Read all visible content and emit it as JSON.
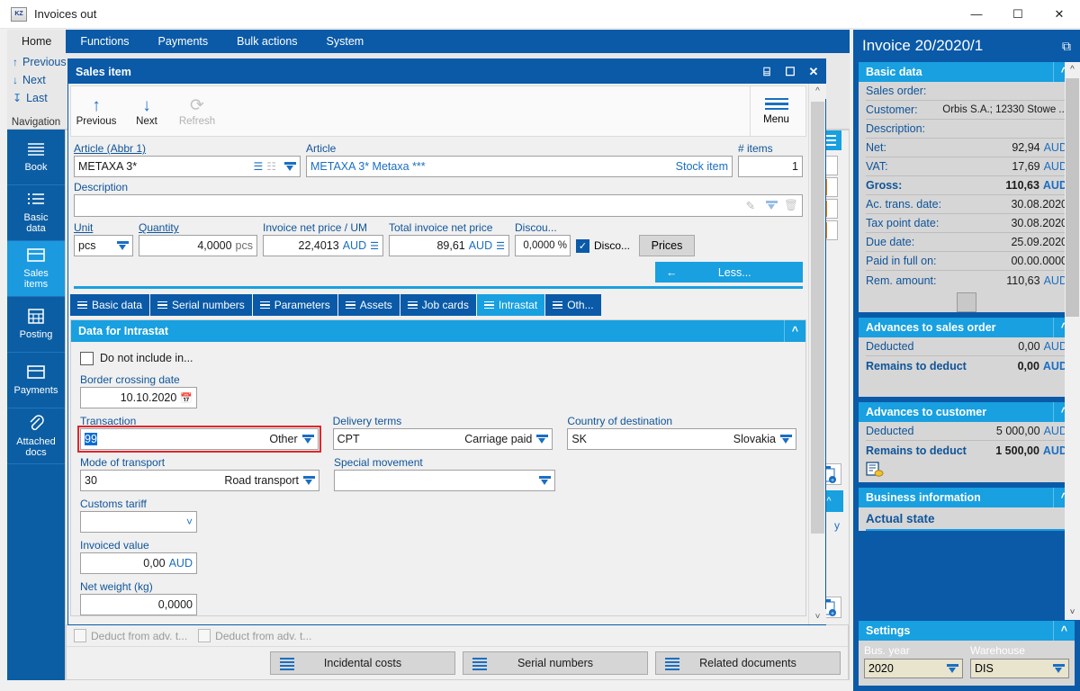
{
  "window": {
    "title": "Invoices out",
    "icon": "app-icon",
    "controls": {
      "minimize": "—",
      "maximize": "☐",
      "close": "✕"
    }
  },
  "ribbon": {
    "tabs": [
      {
        "label": "Home",
        "active": true
      },
      {
        "label": "Functions",
        "active": false
      },
      {
        "label": "Payments",
        "active": false
      },
      {
        "label": "Bulk actions",
        "active": false
      },
      {
        "label": "System",
        "active": false
      }
    ],
    "navigation": {
      "group_label": "Navigation",
      "items": [
        {
          "label": "Previous",
          "arrow": "↑"
        },
        {
          "label": "Next",
          "arrow": "↓"
        },
        {
          "label": "Last",
          "arrow": "↧"
        }
      ]
    }
  },
  "left_nav": {
    "items": [
      {
        "label": "Book",
        "icon": "book-icon",
        "active": false
      },
      {
        "label": "Basic\ndata",
        "icon": "list-icon",
        "active": false
      },
      {
        "label": "Sales\nitems",
        "icon": "box-icon",
        "active": true
      },
      {
        "label": "Posting",
        "icon": "calculator-icon",
        "active": false
      },
      {
        "label": "Payments",
        "icon": "box-icon",
        "active": false
      },
      {
        "label": "Attached\ndocs",
        "icon": "paperclip-icon",
        "active": false
      }
    ]
  },
  "dialog": {
    "title": "Sales item",
    "title_buttons": [
      {
        "name": "save-icon",
        "glyph": "⌸"
      },
      {
        "name": "maximize-icon",
        "glyph": "☐"
      },
      {
        "name": "close-icon",
        "glyph": "✕"
      }
    ],
    "toolbar": {
      "items": [
        {
          "label": "Previous",
          "glyph": "↑",
          "disabled": false
        },
        {
          "label": "Next",
          "glyph": "↓",
          "disabled": false
        },
        {
          "label": "Refresh",
          "glyph": "⟳",
          "disabled": true
        }
      ],
      "menu_label": "Menu"
    },
    "fields": {
      "article_abbr_label": "Article (Abbr 1)",
      "article_abbr_value": "METAXA 3*",
      "article_label": "Article",
      "article_value": "METAXA 3* Metaxa ***",
      "article_suffix": "Stock item",
      "items_label": "# items",
      "items_value": "1",
      "description_label": "Description",
      "description_value": "",
      "unit_label": "Unit",
      "unit_value": "pcs",
      "quantity_label": "Quantity",
      "quantity_value": "4,0000",
      "quantity_unit": "pcs",
      "net_price_label": "Invoice net price / UM",
      "net_price_value": "22,4013",
      "net_price_currency": "AUD",
      "total_net_label": "Total invoice net price",
      "total_net_value": "89,61",
      "total_net_currency": "AUD",
      "discount_label": "Discou...",
      "discount_value": "0,0000 %",
      "discount_check_label": "Disco...",
      "discount_checked": true,
      "prices_button": "Prices",
      "less_button": "Less...",
      "less_arrow": "←"
    },
    "tabs": [
      {
        "label": "Basic data",
        "active": false
      },
      {
        "label": "Serial numbers",
        "active": false
      },
      {
        "label": "Parameters",
        "active": false
      },
      {
        "label": "Assets",
        "active": false
      },
      {
        "label": "Job cards",
        "active": false
      },
      {
        "label": "Intrastat",
        "active": true
      },
      {
        "label": "Oth...",
        "active": false
      }
    ],
    "intrastat": {
      "panel_title": "Data for Intrastat",
      "do_not_include_label": "Do not include in...",
      "do_not_include_checked": false,
      "border_date_label": "Border crossing date",
      "border_date_value": "10.10.2020",
      "transaction_label": "Transaction",
      "transaction_code": "99",
      "transaction_text": "Other",
      "transaction_highlighted": true,
      "delivery_terms_label": "Delivery terms",
      "delivery_terms_code": "CPT",
      "delivery_terms_text": "Carriage paid",
      "country_label": "Country of destination",
      "country_code": "SK",
      "country_text": "Slovakia",
      "mode_label": "Mode of transport",
      "mode_code": "30",
      "mode_text": "Road transport",
      "special_label": "Special movement",
      "special_value": "",
      "customs_label": "Customs tariff",
      "customs_value": "",
      "invoiced_label": "Invoiced value",
      "invoiced_value": "0,00",
      "invoiced_currency": "AUD",
      "weight_label": "Net weight (kg)",
      "weight_value": "0,0000"
    }
  },
  "bottom_bar": {
    "deduct_items": [
      {
        "label": "Deduct from adv. t...",
        "icon": "document-deduct-icon"
      },
      {
        "label": "Deduct from adv. t...",
        "icon": "person-deduct-icon"
      }
    ],
    "buttons": [
      {
        "label": "Incidental costs",
        "icon": "list-icon"
      },
      {
        "label": "Serial numbers",
        "icon": "list-icon"
      },
      {
        "label": "Related documents",
        "icon": "list-icon"
      }
    ]
  },
  "right_panel": {
    "title": "Invoice 20/2020/1",
    "expand_icon": "external-link-icon",
    "sections": [
      {
        "title": "Basic data",
        "rows": [
          {
            "key": "Sales order:",
            "value": "",
            "currency": "",
            "bold": false
          },
          {
            "key": "Customer:",
            "value": "Orbis S.A.; 12330 Stowe ...",
            "currency": "",
            "bold": false
          },
          {
            "key": "Description:",
            "value": "",
            "currency": "",
            "bold": false
          },
          {
            "key": "Net:",
            "value": "92,94",
            "currency": "AUD",
            "bold": false
          },
          {
            "key": "VAT:",
            "value": "17,69",
            "currency": "AUD",
            "bold": false
          },
          {
            "key": "Gross:",
            "value": "110,63",
            "currency": "AUD",
            "bold": true
          },
          {
            "key": "Ac. trans. date:",
            "value": "30.08.2020",
            "currency": "",
            "bold": false
          },
          {
            "key": "Tax point date:",
            "value": "30.08.2020",
            "currency": "",
            "bold": false
          },
          {
            "key": "Due date:",
            "value": "25.09.2020",
            "currency": "",
            "bold": false
          },
          {
            "key": "Paid in full on:",
            "value": "00.00.0000",
            "currency": "",
            "bold": false
          },
          {
            "key": "Rem. amount:",
            "value": "110,63",
            "currency": "AUD",
            "bold": false
          }
        ]
      },
      {
        "title": "Advances to sales order",
        "rows": [
          {
            "key": "Deducted",
            "value": "0,00",
            "currency": "AUD",
            "bold": false
          },
          {
            "key": "Remains to deduct",
            "value": "0,00",
            "currency": "AUD",
            "bold": true
          }
        ]
      },
      {
        "title": "Advances to customer",
        "rows": [
          {
            "key": "Deducted",
            "value": "5 000,00",
            "currency": "AUD",
            "bold": false
          },
          {
            "key": "Remains to deduct",
            "value": "1 500,00",
            "currency": "AUD",
            "bold": true
          }
        ]
      },
      {
        "title": "Business information",
        "subtitle": "Actual state",
        "rows": []
      }
    ],
    "settings": {
      "title": "Settings",
      "bus_year_label": "Bus. year",
      "bus_year_value": "2020",
      "warehouse_label": "Warehouse",
      "warehouse_value": "DIS"
    }
  }
}
